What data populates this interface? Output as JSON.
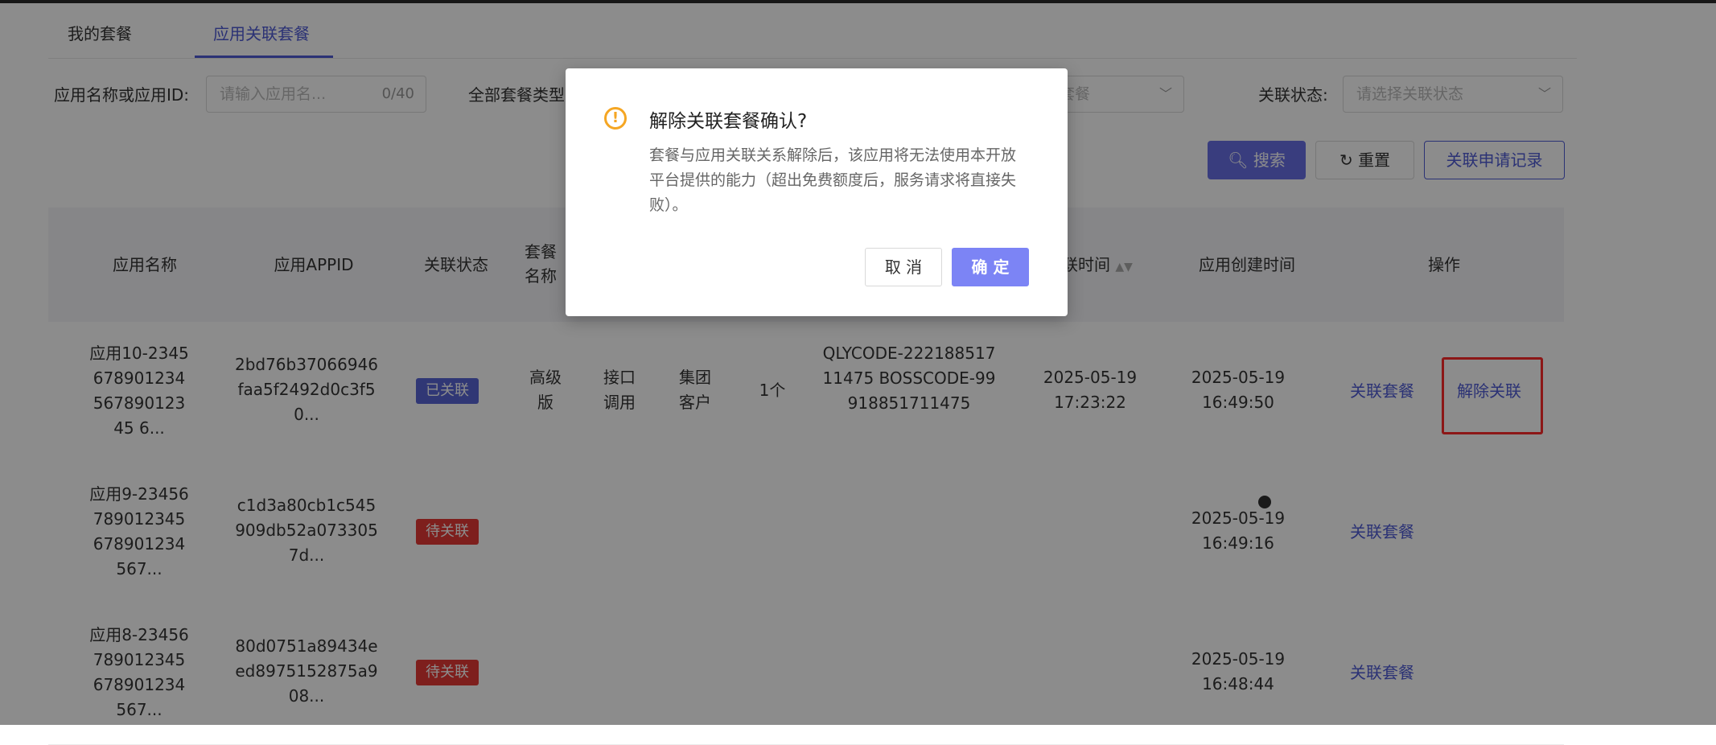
{
  "tabs": {
    "my_packages": "我的套餐",
    "app_packages": "应用关联套餐"
  },
  "filters": {
    "app_label": "应用名称或应用ID:",
    "app_placeholder": "请输入应用名...",
    "app_counter": "0/40",
    "pkg_type_label": "全部套餐类型",
    "pkg_select_value": "套餐",
    "status_label": "关联状态:",
    "status_placeholder": "请选择关联状态"
  },
  "buttons": {
    "search": "搜索",
    "reset": "重置",
    "records": "关联申请记录"
  },
  "table": {
    "headers": {
      "app_name": "应用名称",
      "appid": "应用APPID",
      "status": "关联状态",
      "pkg_name": "套餐名称",
      "link_time": "联时间",
      "created": "应用创建时间",
      "actions": "操作"
    },
    "rows": [
      {
        "app_name": "应用10-234567890123456789012345 6...",
        "appid": "2bd76b37066946faa5f2492d0c3f50...",
        "status": "已关联",
        "pkg_level": "高级版",
        "call_type": "接口调用",
        "customer": "集团客户",
        "count": "1个",
        "codes": "QLYCODE-22218851711475 BOSSCODE-99918851711475",
        "link_time": "2025-05-19 17:23:22",
        "created": "2025-05-19 16:49:50",
        "action1": "关联套餐",
        "action2": "解除关联"
      },
      {
        "app_name": "应用9-23456789012345678901234567...",
        "appid": "c1d3a80cb1c545909db52a0733057d...",
        "status": "待关联",
        "created": "2025-05-19 16:49:16",
        "action1": "关联套餐"
      },
      {
        "app_name": "应用8-23456789012345678901234567...",
        "appid": "80d0751a89434eed8975152875a908...",
        "status": "待关联",
        "created": "2025-05-19 16:48:44",
        "action1": "关联套餐"
      }
    ]
  },
  "dialog": {
    "title": "解除关联套餐确认?",
    "body": "套餐与应用关联关系解除后，该应用将无法使用本开放平台提供的能力（超出免费额度后，服务请求将直接失败）。",
    "cancel": "取 消",
    "ok": "确 定"
  },
  "colors": {
    "accent": "#4f5bd5",
    "primary_button": "#6870e6",
    "linked": "#5865d6",
    "pending": "#e53935",
    "warning": "#f5a623"
  }
}
